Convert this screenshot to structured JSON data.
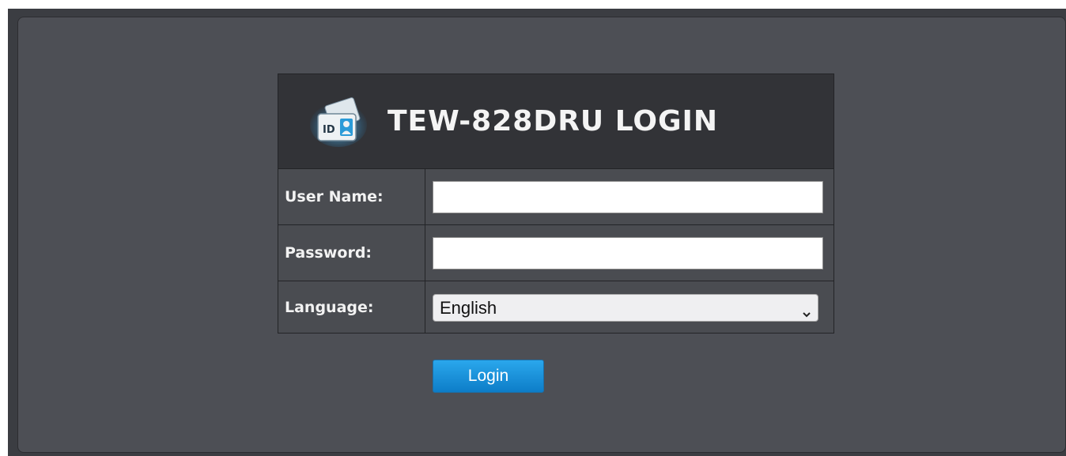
{
  "login": {
    "title": "TEW-828DRU LOGIN",
    "icon": "id-card-icon",
    "username_label": "User Name:",
    "username_value": "",
    "password_label": "Password:",
    "password_value": "",
    "language_label": "Language:",
    "language_selected": "English",
    "login_button": "Login"
  },
  "colors": {
    "background": "#4d4f55",
    "header": "#323337",
    "button": "#1a90db"
  }
}
